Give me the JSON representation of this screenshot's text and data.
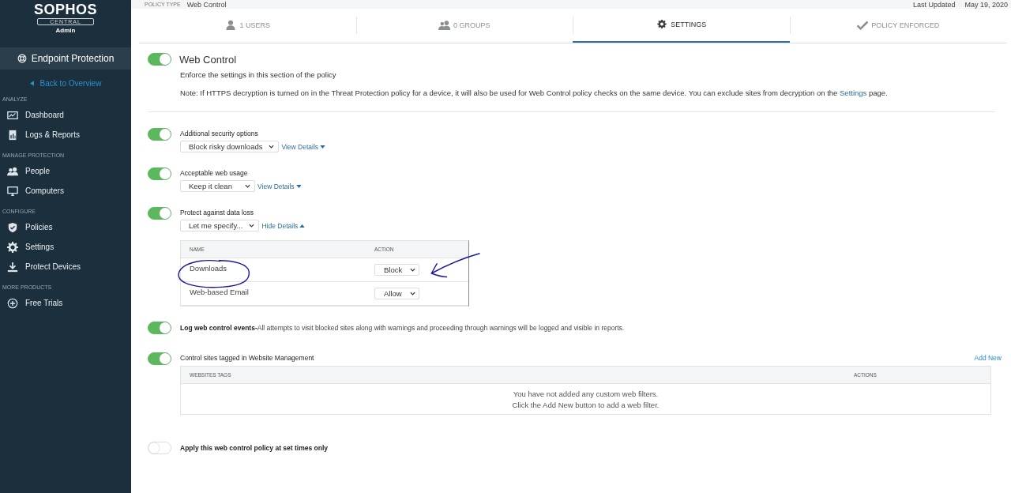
{
  "sidebar": {
    "brand": "SOPHOS",
    "sub": "CENTRAL",
    "role": "Admin",
    "product": "Endpoint Protection",
    "back": "Back to Overview",
    "sections": [
      {
        "title": "ANALYZE",
        "items": [
          {
            "label": "Dashboard",
            "kind": "dashboard"
          },
          {
            "label": "Logs & Reports",
            "kind": "report"
          }
        ]
      },
      {
        "title": "MANAGE PROTECTION",
        "items": [
          {
            "label": "People",
            "kind": "people"
          },
          {
            "label": "Computers",
            "kind": "monitor"
          }
        ]
      },
      {
        "title": "CONFIGURE",
        "items": [
          {
            "label": "Policies",
            "kind": "shield"
          },
          {
            "label": "Settings",
            "kind": "gear"
          },
          {
            "label": "Protect Devices",
            "kind": "download"
          }
        ]
      },
      {
        "title": "MORE PRODUCTS",
        "items": [
          {
            "label": "Free Trials",
            "kind": "plus"
          }
        ]
      }
    ]
  },
  "header": {
    "policy_type_label": "POLICY TYPE",
    "policy_type": "Web Control",
    "updated_label": "Last Updated",
    "updated": "May 19, 2020"
  },
  "tabs": [
    {
      "label": "1 USERS",
      "kind": "user",
      "selected": false
    },
    {
      "label": "0 GROUPS",
      "kind": "group",
      "selected": false
    },
    {
      "label": "SETTINGS",
      "kind": "gear",
      "selected": true
    },
    {
      "label": "POLICY ENFORCED",
      "kind": "check",
      "selected": false
    }
  ],
  "policy": {
    "title": "Web Control",
    "on": true,
    "description": "Enforce the settings in this section of the policy",
    "note_before": "Note: If HTTPS decryption is turned on in the Threat Protection policy for a device, it will also be used for Web Control policy checks on the same device. You can exclude sites from decryption on the",
    "note_link": "Settings",
    "note_after": "page."
  },
  "sections": [
    {
      "kind": "dropdown",
      "on": true,
      "label": "Additional security options",
      "value": "Block risky downloads",
      "details": "View Details",
      "expanded": false
    },
    {
      "kind": "dropdown",
      "on": true,
      "label": "Acceptable web usage",
      "value": "Keep it clean",
      "details": "View Details",
      "expanded": false
    },
    {
      "kind": "dropdown",
      "on": true,
      "label": "Protect against data loss",
      "value": "Let me specify...",
      "details": "Hide Details",
      "expanded": true,
      "columns": [
        "NAME",
        "ACTION"
      ],
      "rows": [
        {
          "name": "Downloads",
          "action": "Block"
        },
        {
          "name": "Web-based Email",
          "action": "Allow"
        }
      ]
    },
    {
      "kind": "text",
      "on": true,
      "label": "Log web control events-",
      "text": "All attempts to visit blocked sites along with warnings and proceeding through warnings will be logged and visible in reports."
    },
    {
      "kind": "tags",
      "on": true,
      "label": "Control sites tagged in Website Management",
      "add": "Add New",
      "columns": [
        "WEBSITES TAGS",
        "ACTIONS"
      ],
      "empty": [
        "You have not added any custom web filters.",
        "Click the Add New button to add a web filter."
      ]
    },
    {
      "kind": "text",
      "on": false,
      "label": "Apply this web control policy at set times only"
    }
  ]
}
